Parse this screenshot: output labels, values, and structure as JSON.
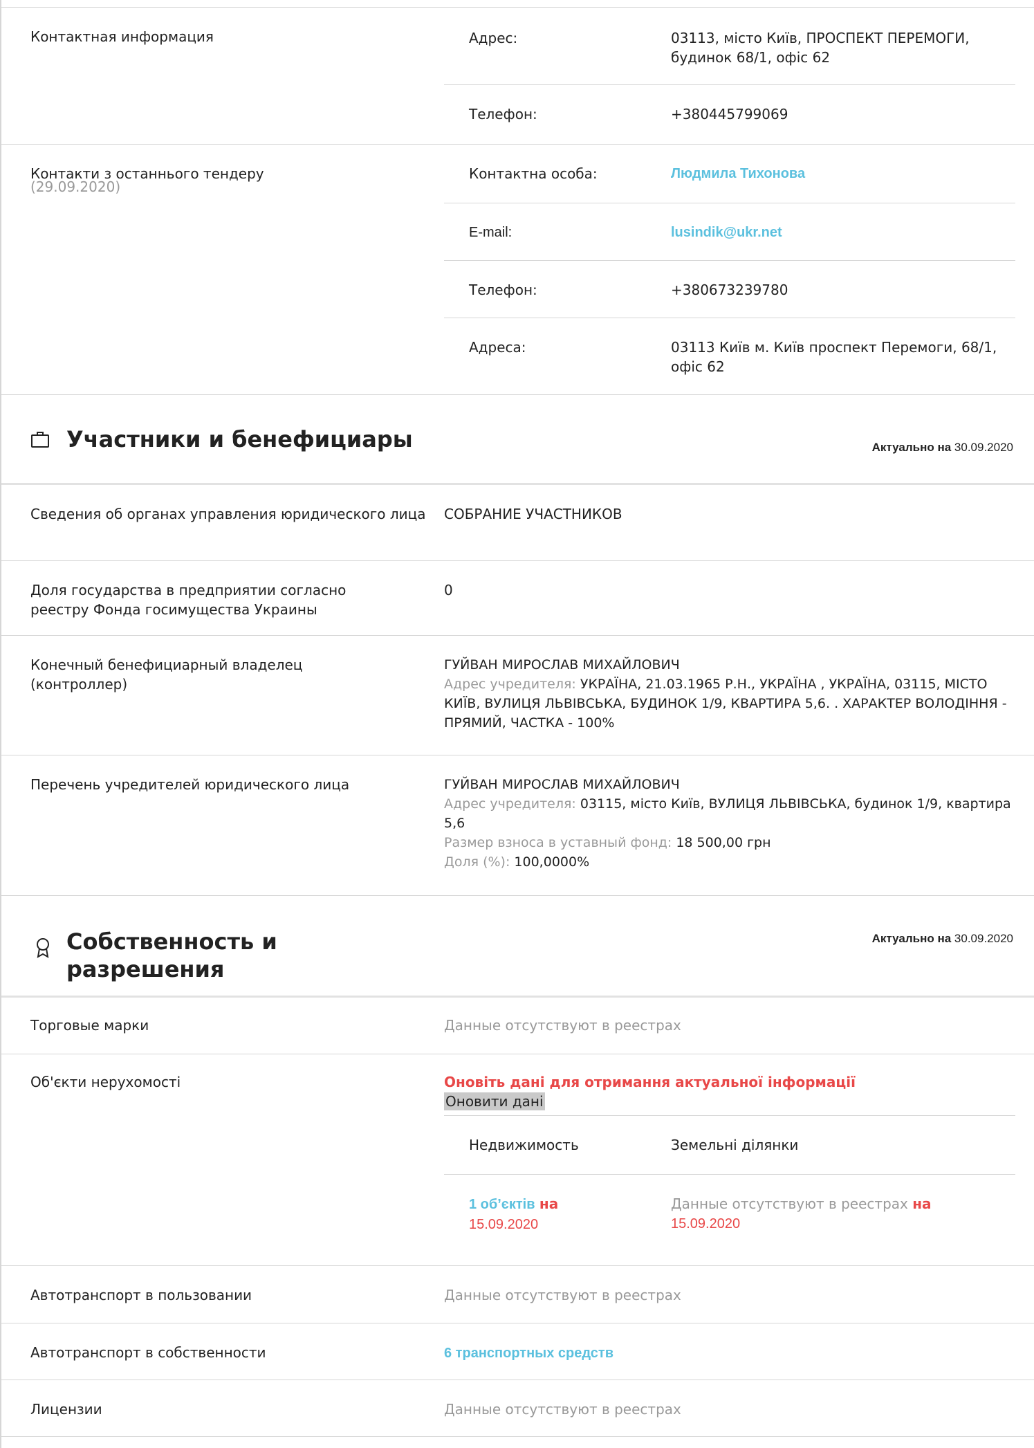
{
  "contact_info": {
    "label": "Контактная информация",
    "address_key": "Адрес:",
    "address_value": "03113, місто Київ, ПРОСПЕКТ ПЕРЕМОГИ, будинок 68/1, офіс 62",
    "phone_key": "Телефон:",
    "phone_value": "+380445799069"
  },
  "tender_contacts": {
    "label": "Контакти з останнього тендеру",
    "date": "(29.09.2020)",
    "person_key": "Контактна особа:",
    "person_value": "Людмила Тихонова",
    "email_key": "E-mail:",
    "email_value": "lusindik@ukr.net",
    "phone_key": "Телефон:",
    "phone_value": "+380673239780",
    "address_key": "Адреса:",
    "address_value": "03113 Київ м. Київ проспект Перемоги, 68/1, офіс 62"
  },
  "participants": {
    "title": "Участники и бенефициары",
    "asof_label": "Актуально на",
    "asof_date": "30.09.2020",
    "rows": {
      "governance_label": "Сведения об органах управления юридического лица",
      "governance_value": "СОБРАНИЕ УЧАСТНИКОВ",
      "state_share_label": "Доля государства в предприятии согласно реестру Фонда госимущества Украины",
      "state_share_value": "0",
      "beneficiary_label": "Конечный бенефициарный владелец (контроллер)",
      "beneficiary_name": "ГУЙВАН МИРОСЛАВ МИХАЙЛОВИЧ",
      "beneficiary_addr_key": "Адрес учредителя:",
      "beneficiary_addr_value": "УКРАЇНА, 21.03.1965 Р.Н., УКРАЇНА , УКРАЇНА, 03115, МІСТО КИЇВ, ВУЛИЦЯ ЛЬВІВСЬКА, БУДИНОК 1/9, КВАРТИРА 5,6. . ХАРАКТЕР ВОЛОДІННЯ - ПРЯМИЙ, ЧАСТКА - 100%",
      "founders_label": "Перечень учредителей юридического лица",
      "founder_name": "ГУЙВАН МИРОСЛАВ МИХАЙЛОВИЧ",
      "founder_addr_key": "Адрес учредителя:",
      "founder_addr_value": "03115, місто Київ, ВУЛИЦЯ ЛЬВІВСЬКА, будинок 1/9, квартира 5,6",
      "founder_contrib_key": "Размер взноса в уставный фонд:",
      "founder_contrib_value": "18 500,00 грн",
      "founder_share_key": "Доля (%):",
      "founder_share_value": "100,0000%"
    }
  },
  "property": {
    "title_line1": "Собственность и",
    "title_line2": "разрешения",
    "asof_label": "Актуально на",
    "asof_date": "30.09.2020",
    "trademarks_label": "Торговые марки",
    "no_data": "Данные отсутствуют в реестрах",
    "realty_label": "Об'єкти нерухомості",
    "update_notice": "Оновіть дані для отримання актуальної інформації",
    "update_button": "Оновити дані",
    "realty_col1": "Недвижимость",
    "realty_col2": "Земельні ділянки",
    "realty_count": "1 об’єктів",
    "on_word": "на",
    "realty_date": "15.09.2020",
    "land_date": "15.09.2020",
    "vehicles_used_label": "Автотранспорт в пользовании",
    "vehicles_owned_label": "Автотранспорт в собственности",
    "vehicles_owned_value": "6 транспортных средств",
    "licenses_label": "Лицензии"
  }
}
